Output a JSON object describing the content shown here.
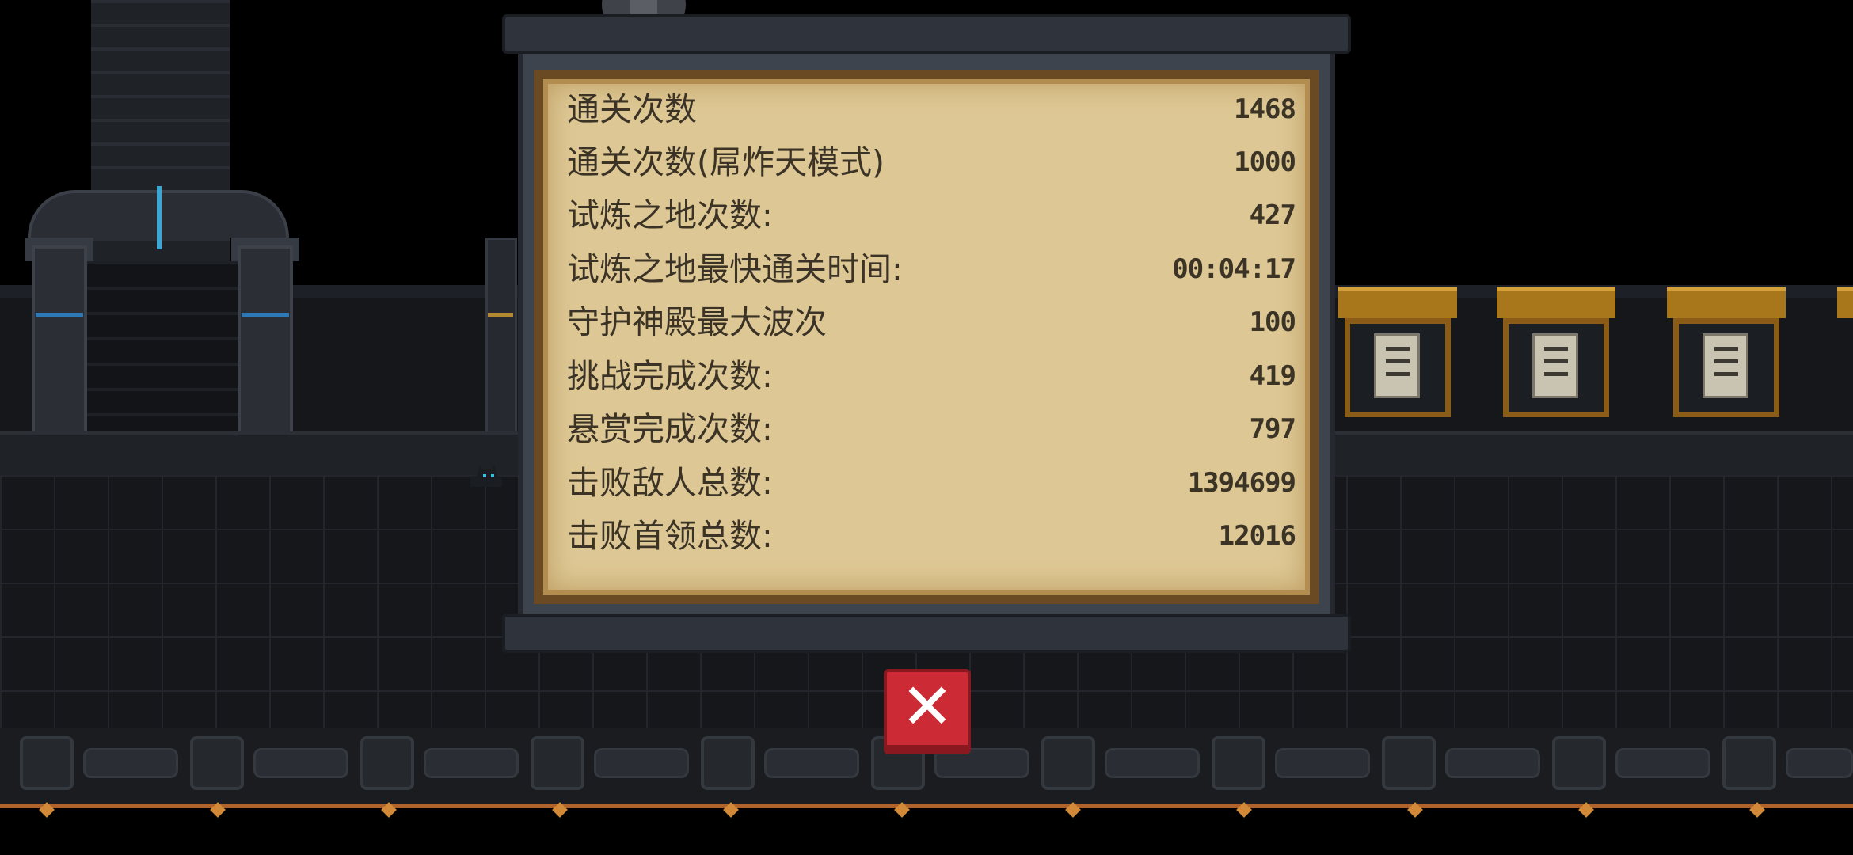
{
  "stats": {
    "rows": [
      {
        "label": "通关次数",
        "value": "1468"
      },
      {
        "label": "通关次数(屌炸天模式)",
        "value": "1000"
      },
      {
        "label": "试炼之地次数:",
        "value": "427"
      },
      {
        "label": "试炼之地最快通关时间:",
        "value": "00:04:17"
      },
      {
        "label": "守护神殿最大波次",
        "value": "100"
      },
      {
        "label": "挑战完成次数:",
        "value": "419"
      },
      {
        "label": "悬赏完成次数:",
        "value": "797"
      },
      {
        "label": "击败敌人总数:",
        "value": "1394699"
      },
      {
        "label": "击败首领总数:",
        "value": "12016"
      }
    ]
  },
  "close_button": {
    "icon": "close-icon",
    "symbol": "✕"
  },
  "colors": {
    "parchment": "#ddc794",
    "panel": "#3e444e",
    "close": "#cc2a35",
    "accent_blue": "#3aa8d6",
    "rail": "#b0632a"
  },
  "icons": {
    "top_icon": "puzzle-icon",
    "cat": "cat-pet-icon",
    "boards": "bounty-board-icon"
  }
}
